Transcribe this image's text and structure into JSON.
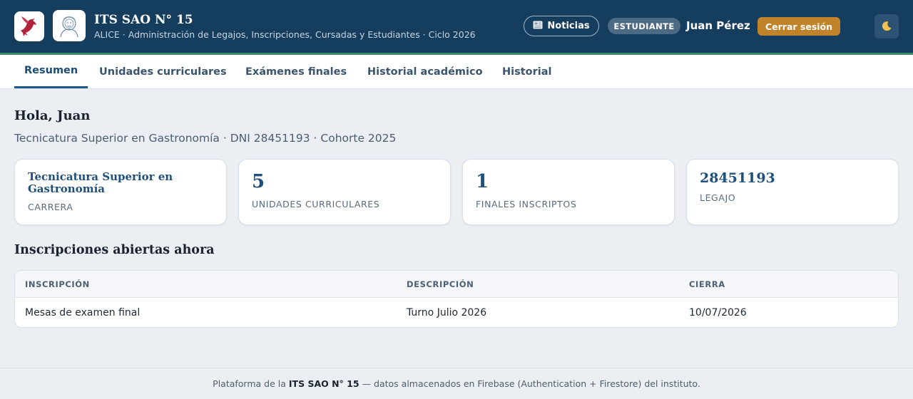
{
  "header": {
    "title": "ITS SAO N° 15",
    "subtitle": "ALICE · Administración de Legajos, Inscripciones, Cursadas y Estudiantes · Ciclo 2026",
    "news_label": "Noticias",
    "news_icon": "newspaper-icon",
    "role_badge": "ESTUDIANTE",
    "user_name": "Juan Pérez",
    "logout_label": "Cerrar sesión",
    "theme_icon": "moon-icon",
    "colors": {
      "bar": "#143d5e",
      "stripe": "#3c8a6a",
      "logout": "#c0832a"
    }
  },
  "tabs": [
    {
      "label": "Resumen",
      "active": true
    },
    {
      "label": "Unidades curriculares",
      "active": false
    },
    {
      "label": "Exámenes finales",
      "active": false
    },
    {
      "label": "Historial académico",
      "active": false
    },
    {
      "label": "Historial",
      "active": false
    }
  ],
  "main": {
    "greeting": "Hola, Juan",
    "subline": "Tecnicatura Superior en Gastronomía · DNI 28451193 · Cohorte 2025",
    "cards": [
      {
        "value": "Tecnicatura Superior en Gastronomía",
        "label": "CARRERA"
      },
      {
        "value": "5",
        "label": "UNIDADES CURRICULARES"
      },
      {
        "value": "1",
        "label": "FINALES INSCRIPTOS"
      },
      {
        "value": "28451193",
        "label": "LEGAJO"
      }
    ],
    "section_title": "Inscripciones abiertas ahora",
    "table": {
      "headers": [
        "INSCRIPCIÓN",
        "DESCRIPCIÓN",
        "CIERRA"
      ],
      "rows": [
        [
          "Mesas de examen final",
          "Turno Julio 2026",
          "10/07/2026"
        ]
      ]
    }
  },
  "footer": {
    "prefix": "Plataforma de la",
    "institution": "ITS SAO N° 15",
    "suffix": "— datos almacenados en Firebase (Authentication + Firestore) del instituto."
  }
}
